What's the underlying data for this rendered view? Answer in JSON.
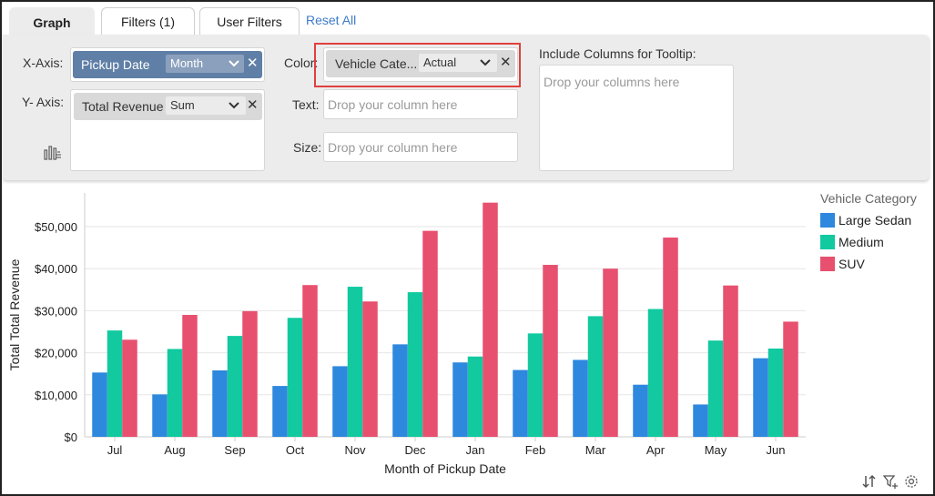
{
  "tabs": [
    {
      "label": "Graph",
      "active": true
    },
    {
      "label": "Filters  (1)",
      "active": false
    },
    {
      "label": "User Filters",
      "active": false
    }
  ],
  "reset_all": "Reset All",
  "x_axis": {
    "label": "X-Axis:",
    "column": "Pickup Date",
    "aggregation": "Month"
  },
  "y_axis": {
    "label": "Y- Axis:",
    "column": "Total Revenue",
    "aggregation": "Sum"
  },
  "color": {
    "label": "Color:",
    "column": "Vehicle Cate...",
    "aggregation": "Actual"
  },
  "text": {
    "label": "Text:",
    "placeholder": "Drop your column here"
  },
  "size": {
    "label": "Size:",
    "placeholder": "Drop your column here"
  },
  "tooltip": {
    "label": "Include Columns for Tooltip:",
    "placeholder": "Drop your columns here"
  },
  "legend": {
    "title": "Vehicle Category",
    "items": [
      {
        "label": "Large Sedan",
        "color": "#2e88de"
      },
      {
        "label": "Medium",
        "color": "#12c9a0"
      },
      {
        "label": "SUV",
        "color": "#e8506f"
      }
    ]
  },
  "chart_data": {
    "type": "bar",
    "xlabel": "Month of Pickup Date",
    "ylabel": "Total Total Revenue",
    "categories": [
      "Jul",
      "Aug",
      "Sep",
      "Oct",
      "Nov",
      "Dec",
      "Jan",
      "Feb",
      "Mar",
      "Apr",
      "May",
      "Jun"
    ],
    "ylim": [
      0,
      58000
    ],
    "yticks": [
      0,
      10000,
      20000,
      30000,
      40000,
      50000
    ],
    "ytick_labels": [
      "$0",
      "$10,000",
      "$20,000",
      "$30,000",
      "$40,000",
      "$50,000"
    ],
    "grid": true,
    "legend_position": "right",
    "series": [
      {
        "name": "Large Sedan",
        "color": "#2e88de",
        "values": [
          15300,
          10100,
          15800,
          12100,
          16800,
          22000,
          17700,
          15900,
          18300,
          12400,
          7700,
          18700
        ]
      },
      {
        "name": "Medium",
        "color": "#12c9a0",
        "values": [
          25300,
          20900,
          24000,
          28300,
          35700,
          34400,
          19100,
          24600,
          28700,
          30400,
          22900,
          21000
        ]
      },
      {
        "name": "SUV",
        "color": "#e8506f",
        "values": [
          23100,
          29000,
          29900,
          36100,
          32200,
          49000,
          55700,
          40900,
          40000,
          47400,
          36000,
          27400
        ]
      }
    ]
  }
}
